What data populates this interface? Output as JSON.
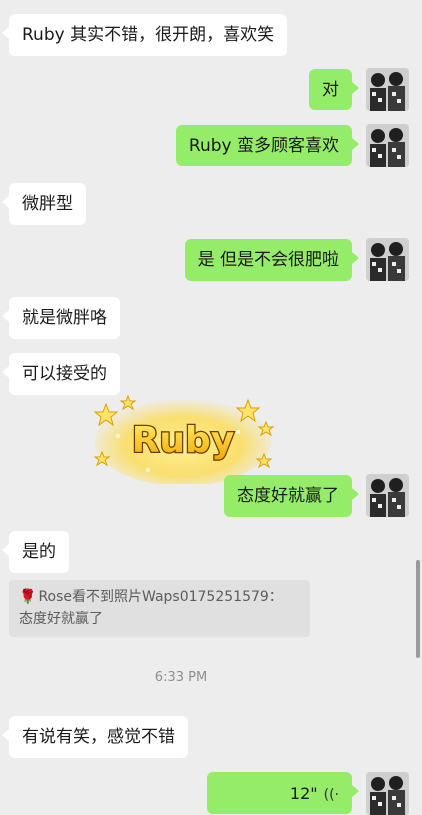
{
  "messages": [
    {
      "id": "m1",
      "side": "in",
      "text": "Ruby 其实不错，很开朗，喜欢笑"
    },
    {
      "id": "m2",
      "side": "out",
      "text": "对"
    },
    {
      "id": "m3",
      "side": "out",
      "text": "Ruby 蛮多顾客喜欢"
    },
    {
      "id": "m4",
      "side": "in",
      "text": "微胖型"
    },
    {
      "id": "m5",
      "side": "out",
      "text": "是 但是不会很肥啦"
    },
    {
      "id": "m6",
      "side": "in",
      "text": "就是微胖咯"
    },
    {
      "id": "m7",
      "side": "in",
      "text": "可以接受的"
    },
    {
      "id": "m8",
      "side": "out",
      "text": "态度好就赢了"
    },
    {
      "id": "m9",
      "side": "in",
      "text": "是的"
    },
    {
      "id": "m10",
      "side": "in",
      "text": "有说有笑，感觉不错"
    }
  ],
  "sticker": {
    "text": "Ruby"
  },
  "quote": {
    "line1": "Rose看不到照片Waps0175251579：",
    "line2": "态度好就赢了",
    "icon": "rose-icon"
  },
  "timestamp": "6:33 PM",
  "voice": {
    "duration": "12\"",
    "icon": "voice-wave-icon"
  },
  "colors": {
    "background": "#ededed",
    "incoming": "#ffffff",
    "outgoing": "#95ec69"
  }
}
